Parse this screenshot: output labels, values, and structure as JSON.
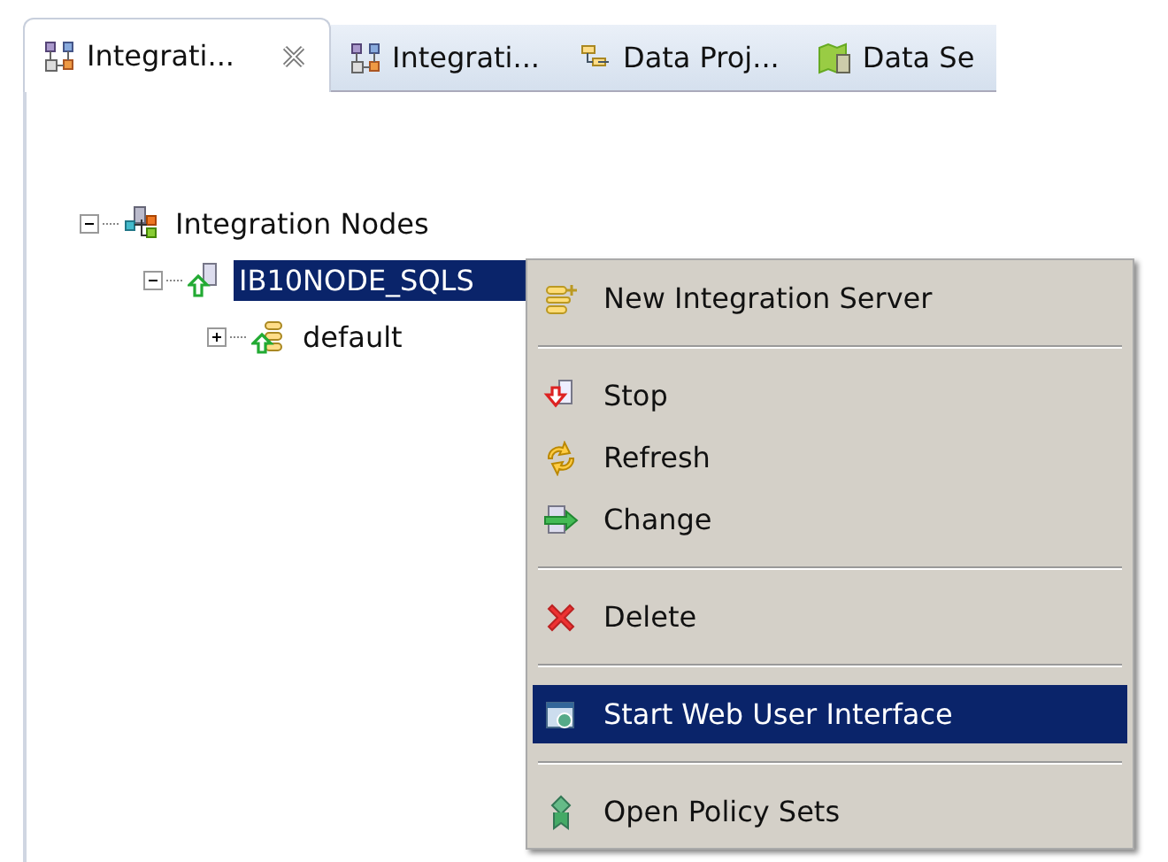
{
  "tabs": [
    {
      "label": "Integrati...",
      "selected": true,
      "closable": true
    },
    {
      "label": "Integrati...",
      "selected": false,
      "closable": false
    },
    {
      "label": "Data Proj...",
      "selected": false,
      "closable": false
    },
    {
      "label": "Data Se",
      "selected": false,
      "closable": false
    }
  ],
  "tree": [
    {
      "label": "Integration Nodes",
      "expanded": true,
      "selected": false,
      "children": [
        {
          "label": "IB10NODE_SQLS",
          "expanded": true,
          "selected": true,
          "children": [
            {
              "label": "default",
              "expanded": false,
              "selected": false
            }
          ]
        }
      ]
    }
  ],
  "context_menu": {
    "items": [
      {
        "kind": "item",
        "label": "New Integration Server",
        "selected": false
      },
      {
        "kind": "separator"
      },
      {
        "kind": "item",
        "label": "Stop",
        "selected": false
      },
      {
        "kind": "item",
        "label": "Refresh",
        "selected": false
      },
      {
        "kind": "item",
        "label": "Change",
        "selected": false
      },
      {
        "kind": "separator"
      },
      {
        "kind": "item",
        "label": "Delete",
        "selected": false
      },
      {
        "kind": "separator"
      },
      {
        "kind": "item",
        "label": "Start Web User Interface",
        "selected": true
      },
      {
        "kind": "separator"
      },
      {
        "kind": "item",
        "label": "Open Policy Sets",
        "selected": false
      }
    ]
  }
}
